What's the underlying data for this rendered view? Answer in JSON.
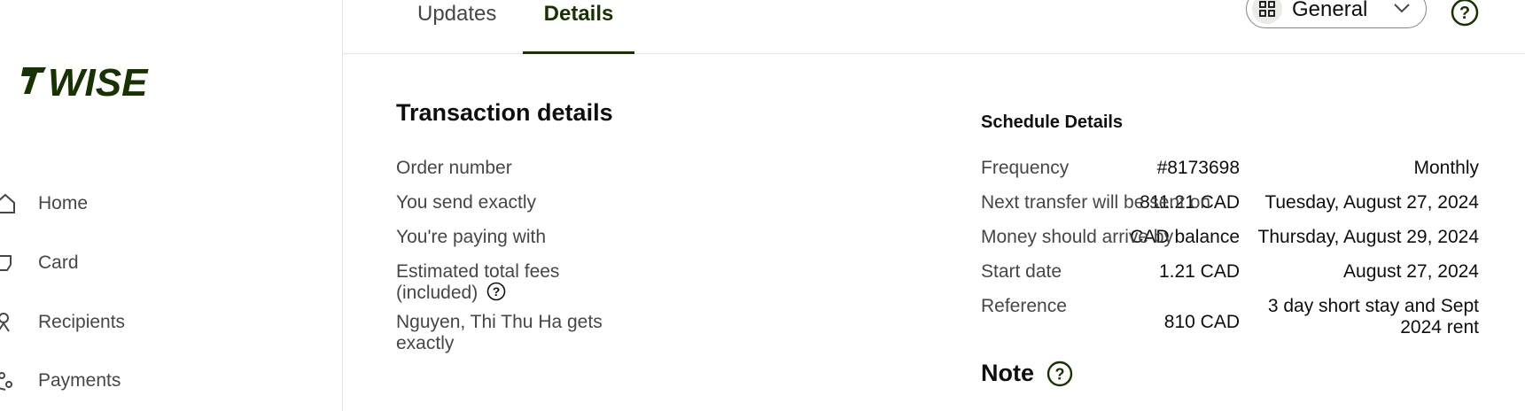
{
  "sidebar": {
    "brand": "WISE",
    "items": [
      {
        "label": "Home",
        "icon": "home-icon"
      },
      {
        "label": "Card",
        "icon": "card-icon"
      },
      {
        "label": "Recipients",
        "icon": "recipients-icon"
      },
      {
        "label": "Payments",
        "icon": "payments-icon"
      }
    ]
  },
  "tabs": [
    {
      "label": "Updates",
      "active": false
    },
    {
      "label": "Details",
      "active": true
    }
  ],
  "account_select": {
    "label": "General",
    "icon": "grid-icon"
  },
  "transaction": {
    "title": "Transaction details",
    "rows": [
      {
        "label": "Order number",
        "value": "#8173698"
      },
      {
        "label": "You send exactly",
        "value": "811.21 CAD"
      },
      {
        "label": "You're paying with",
        "value": "CAD balance"
      },
      {
        "label": "Estimated total fees (included)",
        "value": "1.21 CAD"
      },
      {
        "label": "Nguyen, Thi Thu Ha gets exactly",
        "value": "810 CAD"
      }
    ]
  },
  "schedule": {
    "title": "Schedule Details",
    "rows": [
      {
        "label": "Frequency",
        "value": "Monthly"
      },
      {
        "label": "Next transfer will be sent on",
        "value": "Tuesday, August 27, 2024"
      },
      {
        "label": "Money should arrive by",
        "value": "Thursday, August 29, 2024"
      },
      {
        "label": "Start date",
        "value": "August 27, 2024"
      },
      {
        "label": "Reference",
        "value": "3 day short stay and Sept 2024 rent"
      }
    ]
  },
  "note": {
    "title": "Note"
  },
  "colors": {
    "brand": "#163300",
    "text": "#0e0f0c",
    "muted": "#454745",
    "divider": "#e2e6e2"
  }
}
